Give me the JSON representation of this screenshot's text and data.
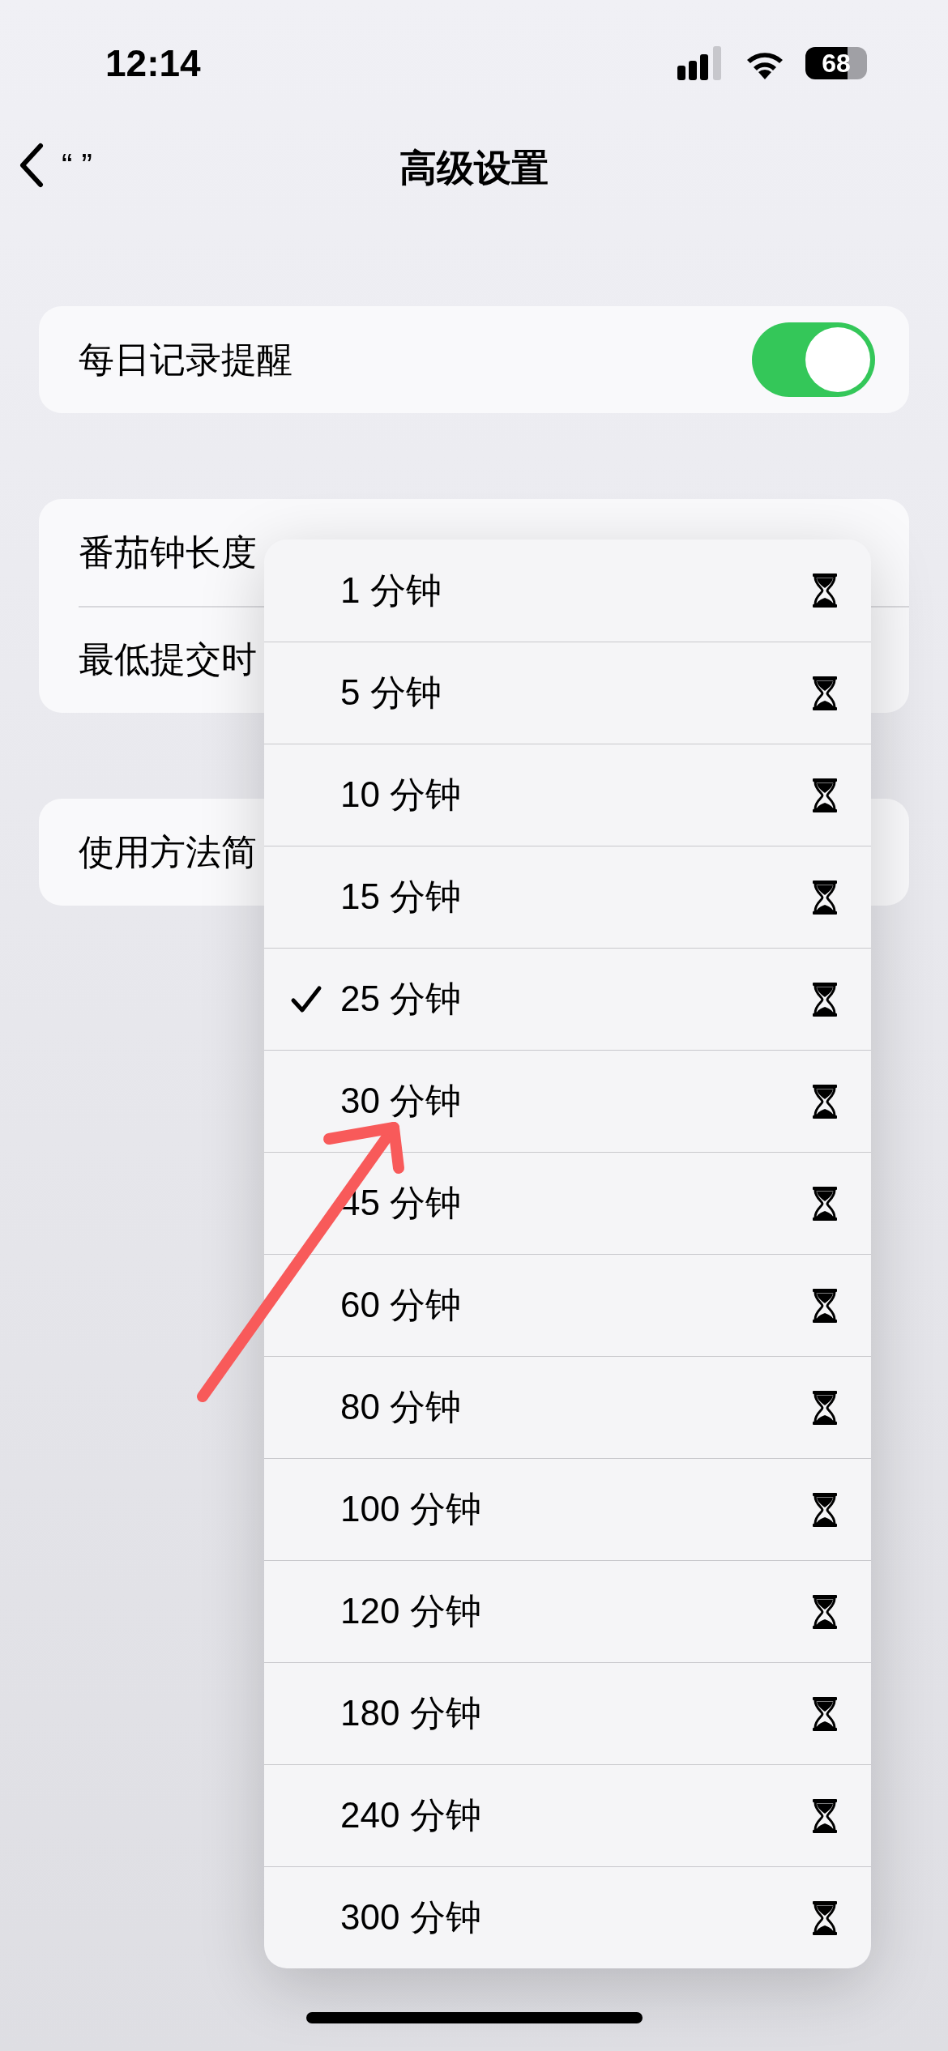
{
  "status_bar": {
    "time": "12:14",
    "battery": "68"
  },
  "nav": {
    "back_label": "“ ”",
    "title": "高级设置"
  },
  "groups": [
    {
      "rows": [
        {
          "label": "每日记录提醒",
          "kind": "toggle",
          "on": true
        }
      ]
    },
    {
      "rows": [
        {
          "label": "番茄钟长度",
          "kind": "plain"
        },
        {
          "label": "最低提交时",
          "kind": "plain"
        }
      ]
    },
    {
      "rows": [
        {
          "label": "使用方法简",
          "kind": "plain"
        }
      ]
    }
  ],
  "menu": {
    "items": [
      {
        "label": "1 分钟",
        "selected": false
      },
      {
        "label": "5 分钟",
        "selected": false
      },
      {
        "label": "10 分钟",
        "selected": false
      },
      {
        "label": "15 分钟",
        "selected": false
      },
      {
        "label": "25 分钟",
        "selected": true
      },
      {
        "label": "30 分钟",
        "selected": false
      },
      {
        "label": "45 分钟",
        "selected": false
      },
      {
        "label": "60 分钟",
        "selected": false
      },
      {
        "label": "80 分钟",
        "selected": false
      },
      {
        "label": "100 分钟",
        "selected": false
      },
      {
        "label": "120 分钟",
        "selected": false
      },
      {
        "label": "180 分钟",
        "selected": false
      },
      {
        "label": "240 分钟",
        "selected": false
      },
      {
        "label": "300 分钟",
        "selected": false
      }
    ]
  }
}
